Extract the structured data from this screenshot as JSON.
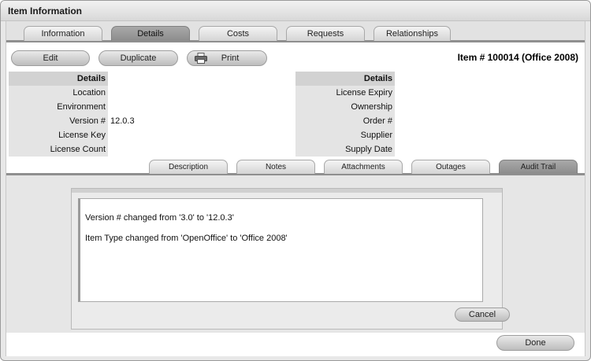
{
  "window": {
    "title": "Item Information"
  },
  "tabs": [
    {
      "label": "Information"
    },
    {
      "label": "Details"
    },
    {
      "label": "Costs"
    },
    {
      "label": "Requests"
    },
    {
      "label": "Relationships"
    }
  ],
  "active_tab": "Details",
  "toolbar": {
    "edit_label": "Edit",
    "duplicate_label": "Duplicate",
    "print_label": "Print"
  },
  "item_number": "Item # 100014 (Office 2008)",
  "details_left": {
    "header": "Details",
    "rows": [
      {
        "label": "Location",
        "value": ""
      },
      {
        "label": "Environment",
        "value": ""
      },
      {
        "label": "Version #",
        "value": "12.0.3"
      },
      {
        "label": "License Key",
        "value": ""
      },
      {
        "label": "License Count",
        "value": ""
      }
    ]
  },
  "details_right": {
    "header": "Details",
    "rows": [
      {
        "label": "License Expiry",
        "value": ""
      },
      {
        "label": "Ownership",
        "value": ""
      },
      {
        "label": "Order #",
        "value": ""
      },
      {
        "label": "Supplier",
        "value": ""
      },
      {
        "label": "Supply Date",
        "value": ""
      }
    ]
  },
  "subtabs": [
    {
      "label": "Description"
    },
    {
      "label": "Notes"
    },
    {
      "label": "Attachments"
    },
    {
      "label": "Outages"
    },
    {
      "label": "Audit Trail"
    }
  ],
  "active_subtab": "Audit Trail",
  "audit_trail": {
    "lines": [
      "Version # changed from '3.0' to '12.0.3'",
      "Item Type changed from 'OpenOffice' to 'Office 2008'"
    ],
    "cancel_label": "Cancel"
  },
  "footer": {
    "done_label": "Done"
  }
}
